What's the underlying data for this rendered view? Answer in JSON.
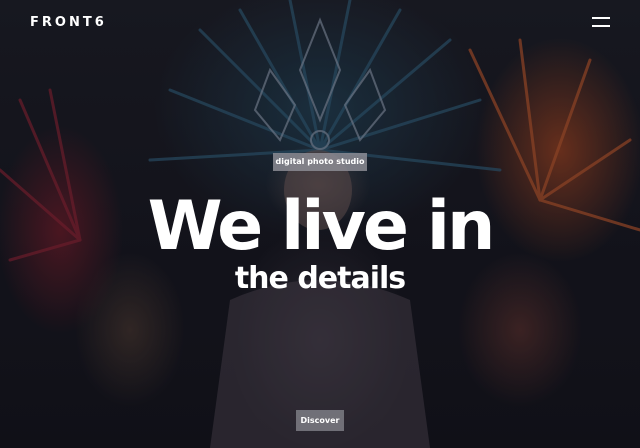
{
  "brand": {
    "logo_text": "FRONT6"
  },
  "nav": {
    "menu_icon": "hamburger-menu-icon"
  },
  "hero": {
    "tag": "digital photo studio",
    "headline": "We live in",
    "subheadline": "the details",
    "cta_label": "Discover",
    "background_image": "dancer-in-feather-headdress"
  },
  "colors": {
    "text": "#ffffff",
    "tag_bg": "#8c8c94",
    "button_bg": "#78787f",
    "dark_bg": "#14131c"
  }
}
